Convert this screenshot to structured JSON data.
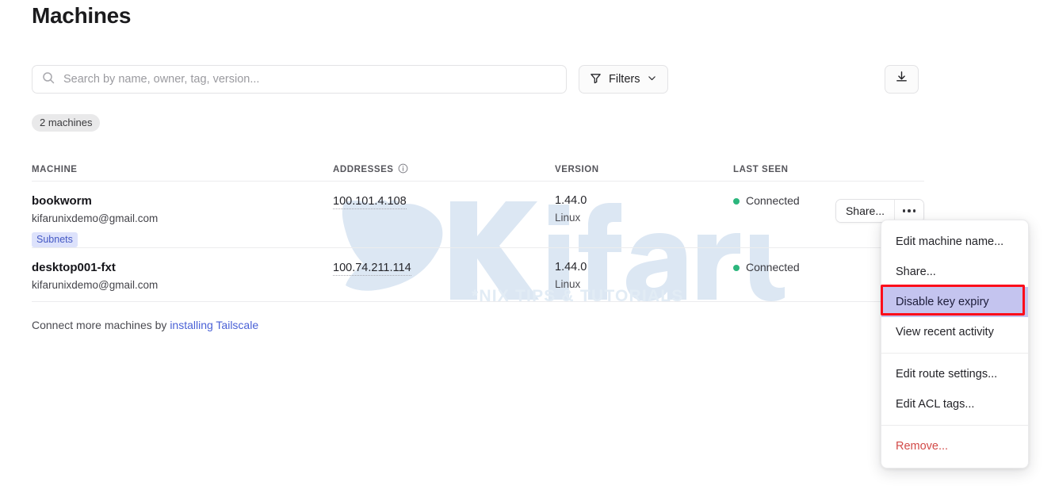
{
  "page": {
    "title": "Machines"
  },
  "toolbar": {
    "search_placeholder": "Search by name, owner, tag, version...",
    "search_value": "",
    "search_icon": "search-icon",
    "filters_label": "Filters",
    "filters_icon": "filter-icon",
    "filters_chevron": "chevron-down-icon",
    "export_icon": "download-icon"
  },
  "count_badge": "2 machines",
  "table": {
    "headers": {
      "machine": "MACHINE",
      "addresses": "ADDRESSES",
      "addresses_info_icon": "info-icon",
      "version": "VERSION",
      "last_seen": "LAST SEEN"
    },
    "rows": [
      {
        "name": "bookworm",
        "owner": "kifarunixdemo@gmail.com",
        "tags": [
          "Subnets"
        ],
        "address": "100.101.4.108",
        "version": "1.44.0",
        "os": "Linux",
        "status": "Connected",
        "status_color": "#2cb67d",
        "share_label": "Share...",
        "more_icon": "ellipsis-icon"
      },
      {
        "name": "desktop001-fxt",
        "owner": "kifarunixdemo@gmail.com",
        "tags": [],
        "address": "100.74.211.114",
        "version": "1.44.0",
        "os": "Linux",
        "status": "Connected",
        "status_color": "#2cb67d"
      }
    ]
  },
  "footer": {
    "text": "Connect more machines by ",
    "link": "installing Tailscale"
  },
  "menu": {
    "items": [
      {
        "label": "Edit machine name...",
        "kind": "normal"
      },
      {
        "label": "Share...",
        "kind": "normal"
      },
      {
        "label": "Disable key expiry",
        "kind": "highlight"
      },
      {
        "label": "View recent activity",
        "kind": "normal"
      },
      {
        "label": "Edit route settings...",
        "kind": "normal"
      },
      {
        "label": "Edit ACL tags...",
        "kind": "normal"
      },
      {
        "label": "Remove...",
        "kind": "danger"
      }
    ],
    "highlight_bg": "#c4c4ef",
    "highlight_ring": "#fc0d1b",
    "danger_color": "#d24a48"
  },
  "watermark": {
    "brand": "Kifarunix",
    "tagline": "*NIX TIPS & TUTORIALS",
    "color": "#dae6f2"
  }
}
